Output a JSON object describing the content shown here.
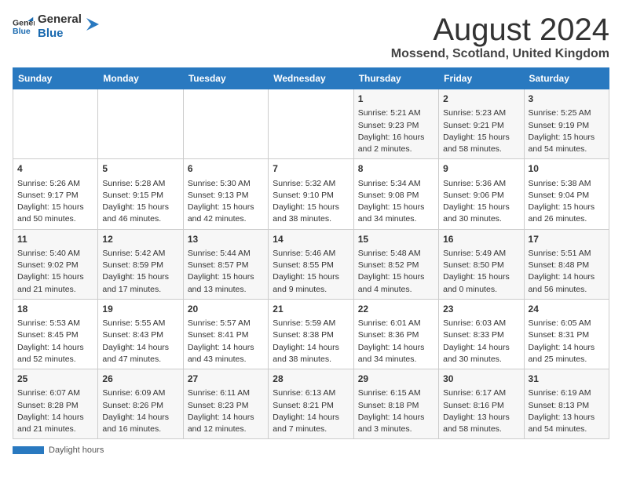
{
  "header": {
    "logo_general": "General",
    "logo_blue": "Blue",
    "month_title": "August 2024",
    "location": "Mossend, Scotland, United Kingdom"
  },
  "days_of_week": [
    "Sunday",
    "Monday",
    "Tuesday",
    "Wednesday",
    "Thursday",
    "Friday",
    "Saturday"
  ],
  "weeks": [
    [
      {
        "num": "",
        "text": ""
      },
      {
        "num": "",
        "text": ""
      },
      {
        "num": "",
        "text": ""
      },
      {
        "num": "",
        "text": ""
      },
      {
        "num": "1",
        "text": "Sunrise: 5:21 AM\nSunset: 9:23 PM\nDaylight: 16 hours\nand 2 minutes."
      },
      {
        "num": "2",
        "text": "Sunrise: 5:23 AM\nSunset: 9:21 PM\nDaylight: 15 hours\nand 58 minutes."
      },
      {
        "num": "3",
        "text": "Sunrise: 5:25 AM\nSunset: 9:19 PM\nDaylight: 15 hours\nand 54 minutes."
      }
    ],
    [
      {
        "num": "4",
        "text": "Sunrise: 5:26 AM\nSunset: 9:17 PM\nDaylight: 15 hours\nand 50 minutes."
      },
      {
        "num": "5",
        "text": "Sunrise: 5:28 AM\nSunset: 9:15 PM\nDaylight: 15 hours\nand 46 minutes."
      },
      {
        "num": "6",
        "text": "Sunrise: 5:30 AM\nSunset: 9:13 PM\nDaylight: 15 hours\nand 42 minutes."
      },
      {
        "num": "7",
        "text": "Sunrise: 5:32 AM\nSunset: 9:10 PM\nDaylight: 15 hours\nand 38 minutes."
      },
      {
        "num": "8",
        "text": "Sunrise: 5:34 AM\nSunset: 9:08 PM\nDaylight: 15 hours\nand 34 minutes."
      },
      {
        "num": "9",
        "text": "Sunrise: 5:36 AM\nSunset: 9:06 PM\nDaylight: 15 hours\nand 30 minutes."
      },
      {
        "num": "10",
        "text": "Sunrise: 5:38 AM\nSunset: 9:04 PM\nDaylight: 15 hours\nand 26 minutes."
      }
    ],
    [
      {
        "num": "11",
        "text": "Sunrise: 5:40 AM\nSunset: 9:02 PM\nDaylight: 15 hours\nand 21 minutes."
      },
      {
        "num": "12",
        "text": "Sunrise: 5:42 AM\nSunset: 8:59 PM\nDaylight: 15 hours\nand 17 minutes."
      },
      {
        "num": "13",
        "text": "Sunrise: 5:44 AM\nSunset: 8:57 PM\nDaylight: 15 hours\nand 13 minutes."
      },
      {
        "num": "14",
        "text": "Sunrise: 5:46 AM\nSunset: 8:55 PM\nDaylight: 15 hours\nand 9 minutes."
      },
      {
        "num": "15",
        "text": "Sunrise: 5:48 AM\nSunset: 8:52 PM\nDaylight: 15 hours\nand 4 minutes."
      },
      {
        "num": "16",
        "text": "Sunrise: 5:49 AM\nSunset: 8:50 PM\nDaylight: 15 hours\nand 0 minutes."
      },
      {
        "num": "17",
        "text": "Sunrise: 5:51 AM\nSunset: 8:48 PM\nDaylight: 14 hours\nand 56 minutes."
      }
    ],
    [
      {
        "num": "18",
        "text": "Sunrise: 5:53 AM\nSunset: 8:45 PM\nDaylight: 14 hours\nand 52 minutes."
      },
      {
        "num": "19",
        "text": "Sunrise: 5:55 AM\nSunset: 8:43 PM\nDaylight: 14 hours\nand 47 minutes."
      },
      {
        "num": "20",
        "text": "Sunrise: 5:57 AM\nSunset: 8:41 PM\nDaylight: 14 hours\nand 43 minutes."
      },
      {
        "num": "21",
        "text": "Sunrise: 5:59 AM\nSunset: 8:38 PM\nDaylight: 14 hours\nand 38 minutes."
      },
      {
        "num": "22",
        "text": "Sunrise: 6:01 AM\nSunset: 8:36 PM\nDaylight: 14 hours\nand 34 minutes."
      },
      {
        "num": "23",
        "text": "Sunrise: 6:03 AM\nSunset: 8:33 PM\nDaylight: 14 hours\nand 30 minutes."
      },
      {
        "num": "24",
        "text": "Sunrise: 6:05 AM\nSunset: 8:31 PM\nDaylight: 14 hours\nand 25 minutes."
      }
    ],
    [
      {
        "num": "25",
        "text": "Sunrise: 6:07 AM\nSunset: 8:28 PM\nDaylight: 14 hours\nand 21 minutes."
      },
      {
        "num": "26",
        "text": "Sunrise: 6:09 AM\nSunset: 8:26 PM\nDaylight: 14 hours\nand 16 minutes."
      },
      {
        "num": "27",
        "text": "Sunrise: 6:11 AM\nSunset: 8:23 PM\nDaylight: 14 hours\nand 12 minutes."
      },
      {
        "num": "28",
        "text": "Sunrise: 6:13 AM\nSunset: 8:21 PM\nDaylight: 14 hours\nand 7 minutes."
      },
      {
        "num": "29",
        "text": "Sunrise: 6:15 AM\nSunset: 8:18 PM\nDaylight: 14 hours\nand 3 minutes."
      },
      {
        "num": "30",
        "text": "Sunrise: 6:17 AM\nSunset: 8:16 PM\nDaylight: 13 hours\nand 58 minutes."
      },
      {
        "num": "31",
        "text": "Sunrise: 6:19 AM\nSunset: 8:13 PM\nDaylight: 13 hours\nand 54 minutes."
      }
    ]
  ],
  "footer": {
    "daylight_hours_label": "Daylight hours"
  }
}
